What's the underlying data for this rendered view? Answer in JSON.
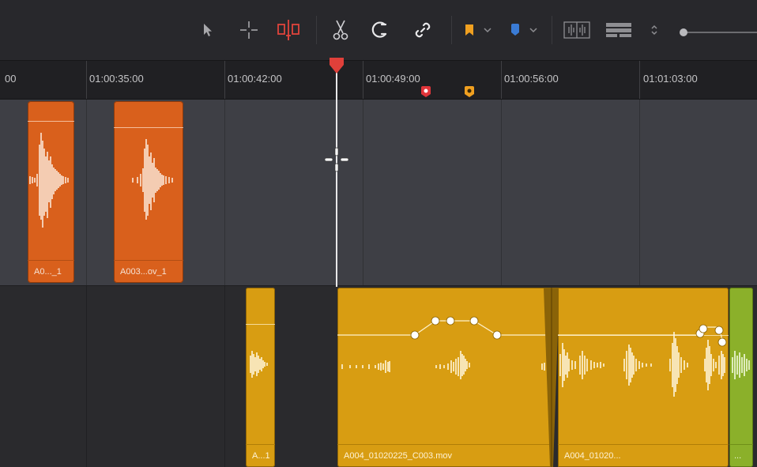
{
  "toolbar": {
    "tools": [
      {
        "name": "selection-arrow-icon"
      },
      {
        "name": "trim-crosshair-icon"
      },
      {
        "name": "insert-marker-icon",
        "color": "#e0443c"
      },
      {
        "name": "blade-scissors-icon"
      },
      {
        "name": "snapping-magnet-icon"
      },
      {
        "name": "linked-selection-icon"
      },
      {
        "name": "flag-icon",
        "color": "#f0a020"
      },
      {
        "name": "marker-icon",
        "color": "#3a7bd5"
      },
      {
        "name": "audio-waveform-view-icon"
      },
      {
        "name": "track-height-view-icon"
      },
      {
        "name": "zoom-updown-icon"
      }
    ]
  },
  "ruler": {
    "partial_label": "00",
    "labels": [
      "01:00:35:00",
      "01:00:42:00",
      "01:00:49:00",
      "01:00:56:00",
      "01:01:03:00"
    ],
    "markers": [
      {
        "color": "#e0353a",
        "name": "red-marker"
      },
      {
        "color": "#f0a020",
        "name": "yellow-marker"
      }
    ]
  },
  "track1": {
    "clips": [
      {
        "name": "A0..._1",
        "color": "#d9601c"
      },
      {
        "name": "A003...ov_1",
        "color": "#d9601c"
      }
    ]
  },
  "track2": {
    "clips": [
      {
        "name": "A...1",
        "color": "#d89d12"
      },
      {
        "name": "A004_01020225_C003.mov",
        "color": "#d89d12"
      },
      {
        "name": "A004_01020...",
        "color": "#d89d12"
      },
      {
        "name": "...",
        "color": "#8bb02a"
      }
    ]
  },
  "playhead": {
    "color": "#e0403a"
  }
}
